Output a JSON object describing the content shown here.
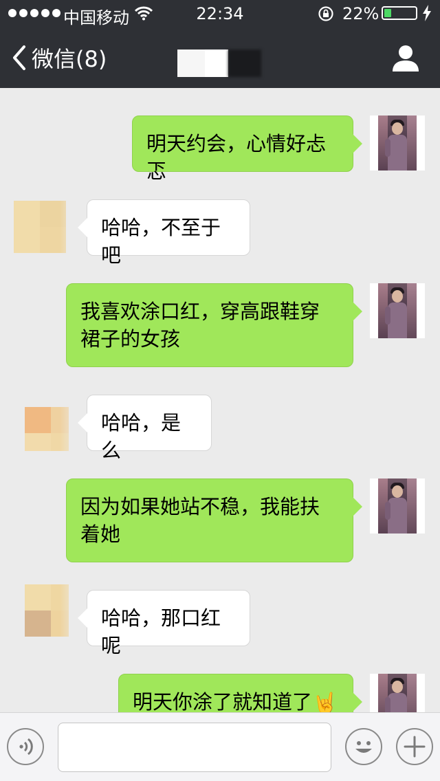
{
  "status_bar": {
    "carrier": "中国移动",
    "time": "22:34",
    "battery_percent": "22%",
    "battery_level": 0.22,
    "signal_dots": 5
  },
  "nav": {
    "back_label": "微信(8)",
    "back_icon": "chevron-left-icon",
    "profile_icon": "person-icon"
  },
  "colors": {
    "header_bg": "#2e3035",
    "chat_bg": "#ebebeb",
    "outgoing_bubble": "#a0e75a",
    "incoming_bubble": "#ffffff",
    "battery_fill": "#4cd964"
  },
  "messages": [
    {
      "sender": "me",
      "text": "明天约会，心情好忐忑"
    },
    {
      "sender": "them",
      "text": "哈哈，不至于吧"
    },
    {
      "sender": "me",
      "text": "我喜欢涂口红，穿高跟鞋穿裙子的女孩"
    },
    {
      "sender": "them",
      "text": "哈哈，是么"
    },
    {
      "sender": "me",
      "text": "因为如果她站不稳，我能扶着她"
    },
    {
      "sender": "them",
      "text": "哈哈，那口红呢"
    },
    {
      "sender": "me",
      "text": "明天你涂了就知道了",
      "emoji": "🤘"
    }
  ],
  "input_bar": {
    "voice_icon": "voice-icon",
    "message_value": "",
    "emoji_icon": "smiley-icon",
    "more_icon": "plus-icon"
  }
}
